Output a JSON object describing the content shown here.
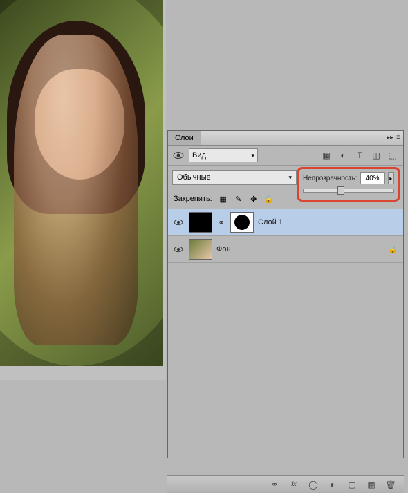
{
  "panel": {
    "tab_label": "Слои",
    "view_label": "Вид"
  },
  "blend": {
    "mode": "Обычные"
  },
  "opacity": {
    "label": "Непрозрачность:",
    "value": "40%"
  },
  "lock": {
    "label": "Закрепить:"
  },
  "layers": [
    {
      "name": "Слой 1",
      "selected": true,
      "has_mask": true,
      "locked": false
    },
    {
      "name": "Фон",
      "selected": false,
      "has_mask": false,
      "locked": true
    }
  ],
  "icons": {
    "filter": "▦",
    "adjust": "◐",
    "text": "T",
    "shape": "◫",
    "smart": "⬚",
    "link": "⬚",
    "brush": "✎",
    "move": "✥",
    "lock": "🔒",
    "eye": "👁",
    "chain": "⚭",
    "fx": "fx.",
    "mask": "◯",
    "folder": "▢",
    "new": "▦",
    "trash": "🗑"
  }
}
